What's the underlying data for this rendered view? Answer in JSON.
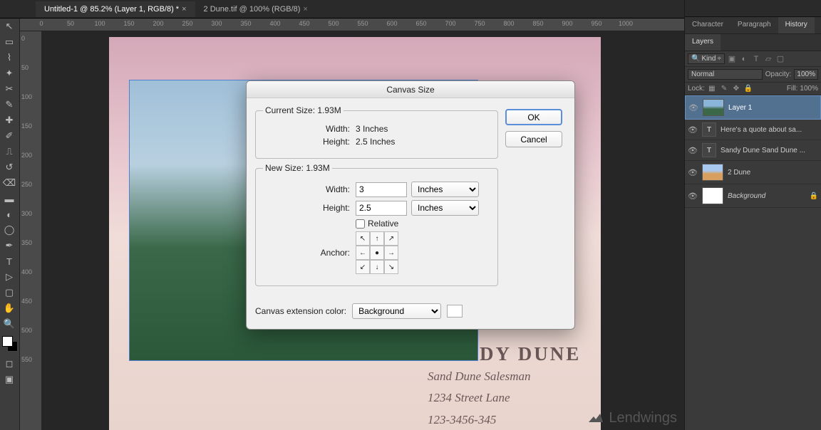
{
  "tabs": {
    "file1": "Untitled-1 @ 85.2% (Layer 1, RGB/8) *",
    "file2": "2 Dune.tif @ 100% (RGB/8)"
  },
  "ruler_h": [
    "0",
    "50",
    "100",
    "150",
    "200",
    "250",
    "300",
    "350",
    "400",
    "450",
    "500",
    "550",
    "600",
    "650",
    "700",
    "750",
    "800",
    "850",
    "900",
    "950",
    "1000"
  ],
  "ruler_v": [
    "0",
    "50",
    "100",
    "150",
    "200",
    "250",
    "300",
    "350",
    "400",
    "450",
    "500",
    "550"
  ],
  "canvas_text": {
    "t1": "DY DUNE",
    "t2": "Sand Dune Salesman",
    "t3": "1234 Street Lane",
    "t4": "123-3456-345"
  },
  "watermark": "Lendwings",
  "panels": {
    "tab_character": "Character",
    "tab_paragraph": "Paragraph",
    "tab_history": "History",
    "tab_layers": "Layers",
    "kind": "Kind",
    "blend_mode": "Normal",
    "opacity_label": "Opacity:",
    "opacity_value": "100%",
    "lock_label": "Lock:",
    "fill_label": "Fill:",
    "fill_value": "100%",
    "layers": [
      {
        "name": "Layer 1"
      },
      {
        "name": "Here's a quote about sa..."
      },
      {
        "name": "Sandy Dune Sand Dune ..."
      },
      {
        "name": "2 Dune"
      },
      {
        "name": "Background"
      }
    ]
  },
  "dialog": {
    "title": "Canvas Size",
    "current_label": "Current Size:",
    "current_size": "1.93M",
    "width_label": "Width:",
    "cur_width": "3 Inches",
    "height_label": "Height:",
    "cur_height": "2.5 Inches",
    "new_label": "New Size:",
    "new_size": "1.93M",
    "new_width": "3",
    "new_height": "2.5",
    "unit": "Inches",
    "relative": "Relative",
    "anchor": "Anchor:",
    "ext_label": "Canvas extension color:",
    "ext_value": "Background",
    "ok": "OK",
    "cancel": "Cancel"
  }
}
